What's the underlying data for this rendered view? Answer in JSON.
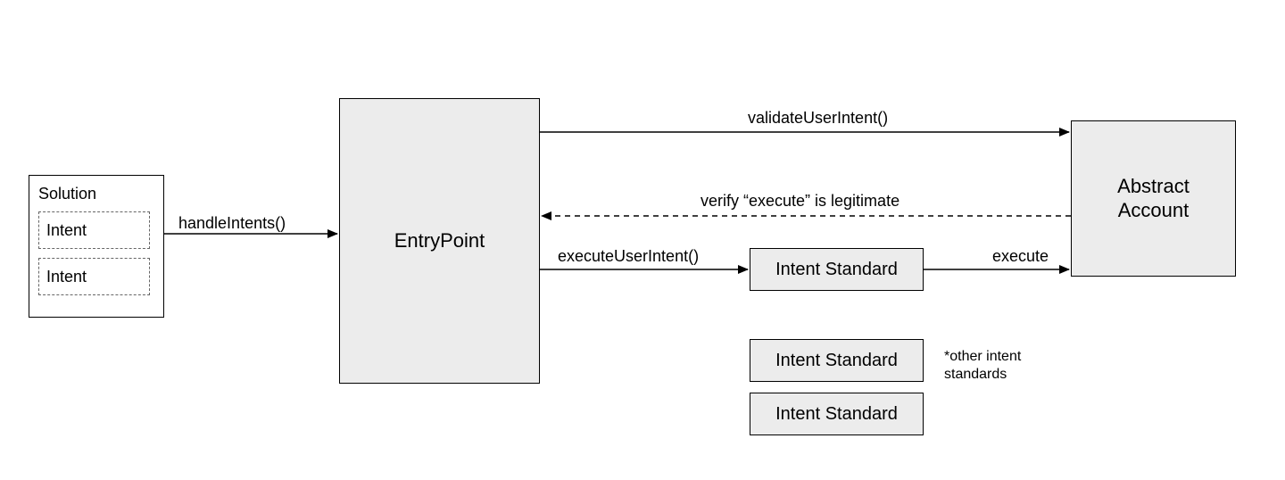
{
  "solution": {
    "title": "Solution",
    "intent1": "Intent",
    "intent2": "Intent"
  },
  "entrypoint": {
    "label": "EntryPoint"
  },
  "abstract_account": {
    "line1": "Abstract",
    "line2": "Account"
  },
  "intent_std1": {
    "label": "Intent Standard"
  },
  "intent_std2": {
    "label": "Intent Standard"
  },
  "intent_std3": {
    "label": "Intent Standard"
  },
  "arrows": {
    "handleIntents": "handleIntents()",
    "validateUserIntent": "validateUserIntent()",
    "verifyExecute": "verify “execute” is legitimate",
    "executeUserIntent": "executeUserIntent()",
    "execute": "execute"
  },
  "note": {
    "line1": "*other intent",
    "line2": "standards"
  }
}
